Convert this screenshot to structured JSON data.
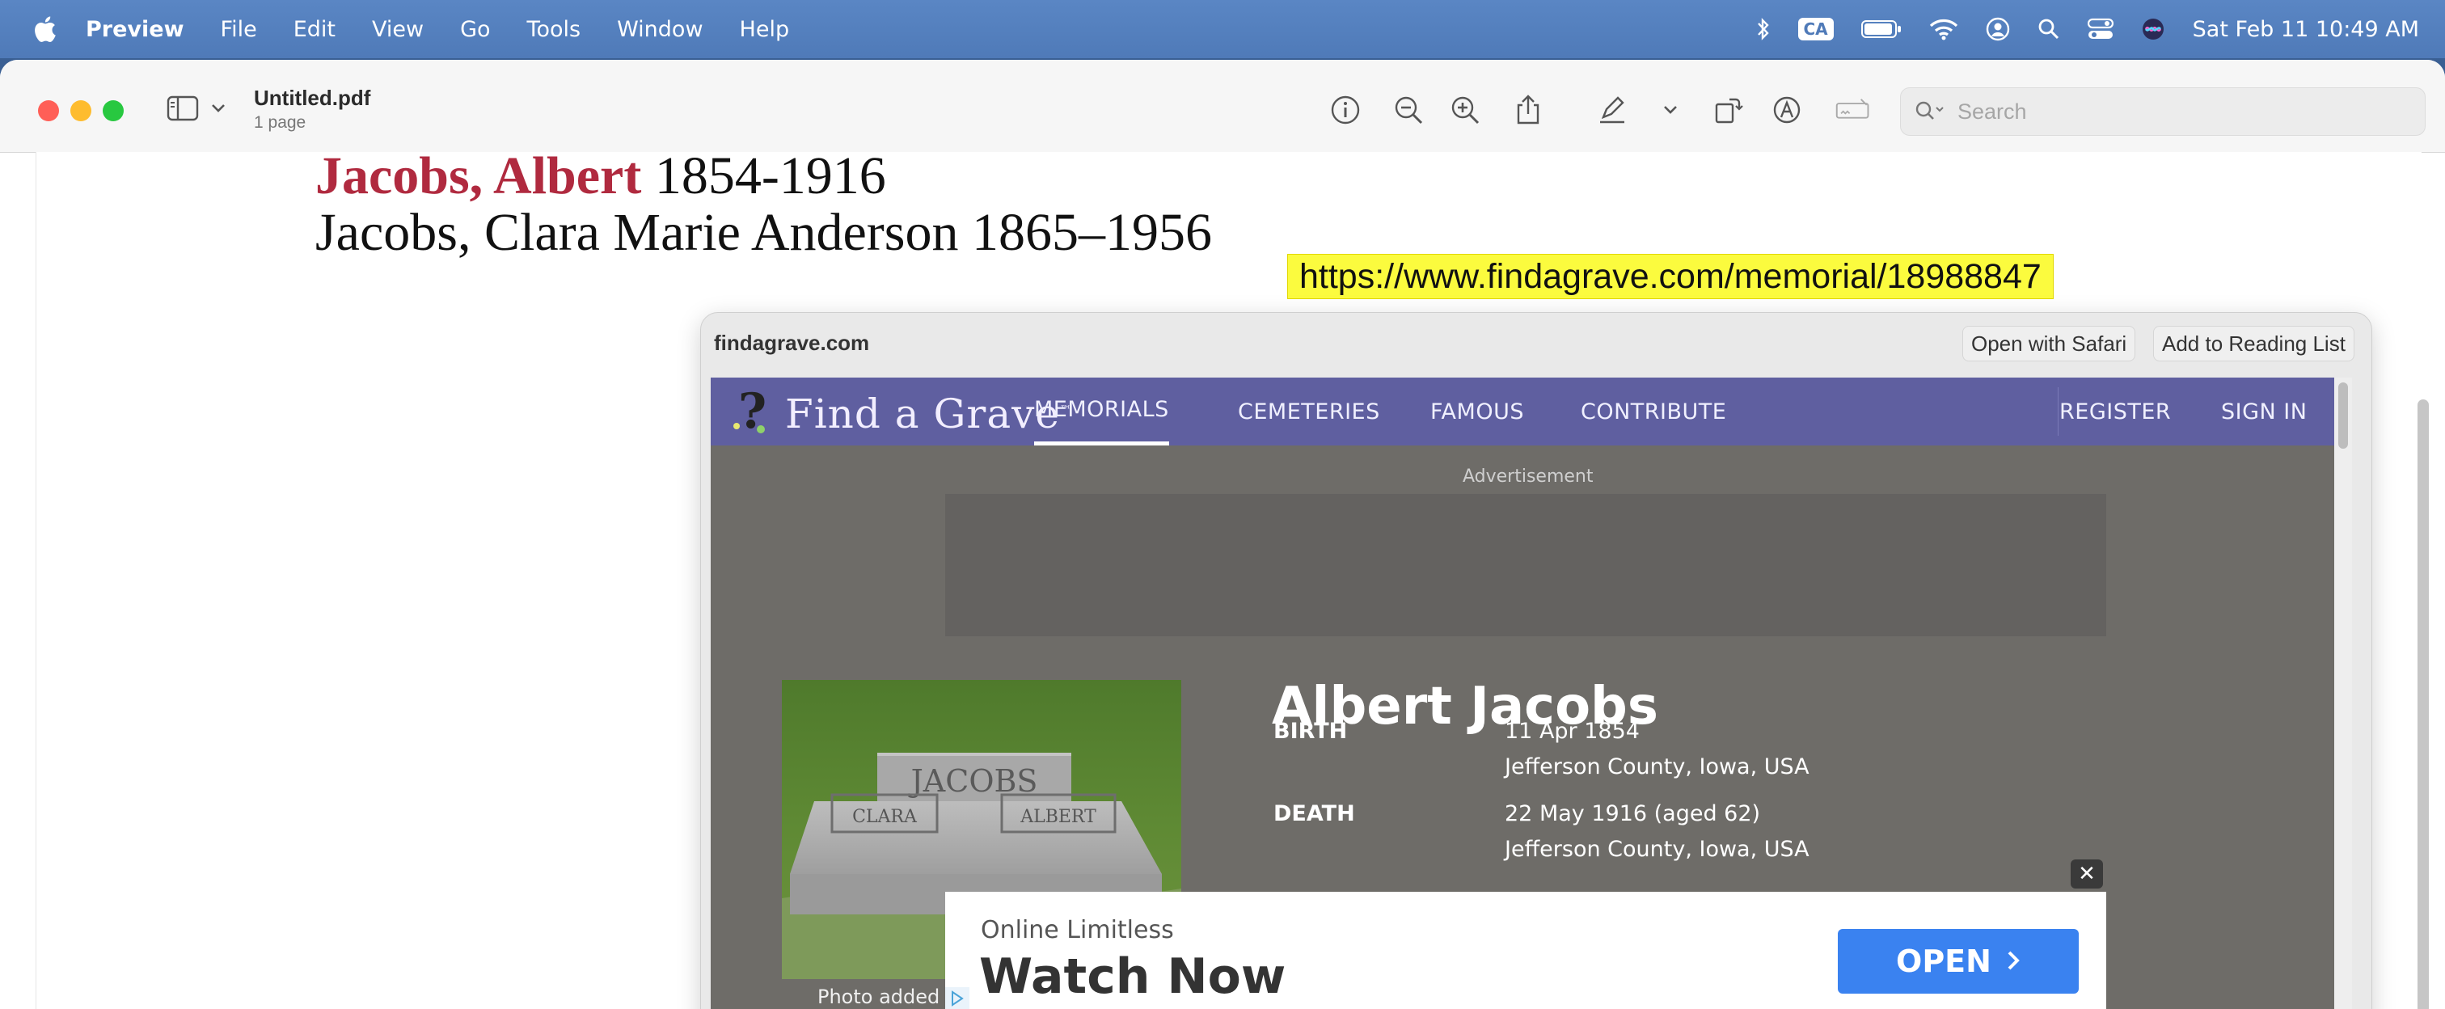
{
  "menubar": {
    "app": "Preview",
    "items": [
      "File",
      "Edit",
      "View",
      "Go",
      "Tools",
      "Window",
      "Help"
    ],
    "input_source": "CA",
    "clock": "Sat Feb 11  10:49 AM",
    "icons": [
      "apple-icon",
      "bluetooth-icon",
      "battery-icon",
      "wifi-icon",
      "user-icon",
      "spotlight-icon",
      "control-center-icon",
      "siri-icon"
    ]
  },
  "window": {
    "doc_title": "Untitled.pdf",
    "doc_subtitle": "1 page",
    "search_placeholder": "Search"
  },
  "pdf": {
    "line1_name": "Jacobs, Albert",
    "line1_years": " 1854-1916",
    "line2": "Jacobs, Clara Marie Anderson 1865–1956",
    "url": "https://www.findagrave.com/memorial/18988847"
  },
  "popover": {
    "domain": "findagrave.com",
    "open_safari": "Open with Safari",
    "reading_list": "Add to Reading List"
  },
  "findagrave": {
    "logo": "Find a Grave",
    "tm": "™",
    "nav": [
      "MEMORIALS",
      "CEMETERIES",
      "FAMOUS",
      "CONTRIBUTE",
      "REGISTER",
      "SIGN IN"
    ],
    "ad_label": "Advertisement",
    "photo_caption": "Photo added b",
    "name": "Albert Jacobs",
    "birth_label": "BIRTH",
    "birth_date": "11 Apr 1854",
    "birth_place": "Jefferson County, Iowa, USA",
    "death_label": "DEATH",
    "death_date": "22 May 1916 (aged 62)",
    "death_place": "Jefferson County, Iowa, USA",
    "headstone_family": "JACOBS",
    "headstone_left": "CLARA",
    "headstone_right": "ALBERT"
  },
  "ad": {
    "close": "✕",
    "small": "Online Limitless",
    "big": "Watch Now",
    "button": "OPEN"
  },
  "colors": {
    "menubar": "#4f7ab8",
    "fg_nav": "#5f5fa0",
    "highlight": "#fbfb3e",
    "name_red": "#b02a3f",
    "open_blue": "#3a82f0"
  }
}
